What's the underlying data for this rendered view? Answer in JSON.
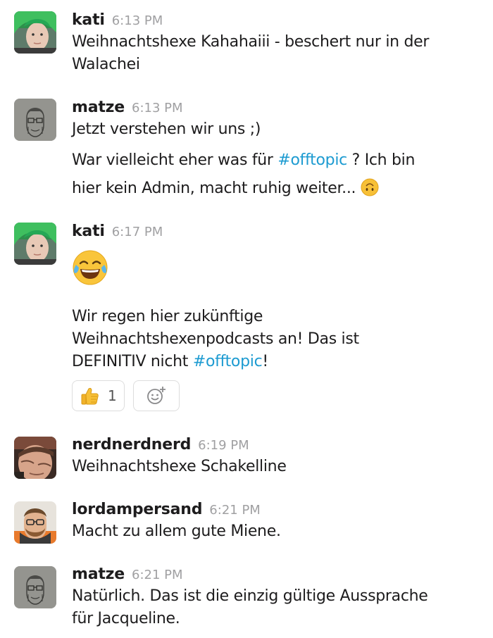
{
  "messages": [
    {
      "author": "kati",
      "time": "6:13 PM",
      "lines": [
        "Weihnachtshexe Kahahaiii - beschert nur in der",
        "Walachei"
      ]
    },
    {
      "author": "matze",
      "time": "6:13 PM",
      "text1": "Jetzt verstehen wir uns ;)",
      "text2_pre": "War vielleicht eher was für ",
      "text2_channel": "#offtopic",
      "text2_post": " ? Ich bin",
      "text3": "hier kein Admin, macht ruhig weiter... ",
      "text3_emoji": "upside-down-face-icon"
    },
    {
      "author": "kati",
      "time": "6:17 PM",
      "emoji": "joy-icon",
      "line1": "Wir regen hier zukünftige",
      "line2": "Weihnachtshexenpodcasts an! Das ist",
      "line3_pre": "DEFINITIV nicht ",
      "line3_channel": "#offtopic",
      "line3_post": "!",
      "reaction": {
        "emoji": "thumbs-up-icon",
        "count": "1"
      }
    },
    {
      "author": "nerdnerdnerd",
      "time": "6:19 PM",
      "text": "Weihnachtshexe Schakelline"
    },
    {
      "author": "lordampersand",
      "time": "6:21 PM",
      "text": "Macht zu allem gute Miene."
    },
    {
      "author": "matze",
      "time": "6:21 PM",
      "lines": [
        "Natürlich. Das ist die einzig gültige Aussprache",
        "für Jacqueline."
      ]
    }
  ],
  "colors": {
    "channel_link": "#1d9bd1",
    "timestamp": "#a0a0a2",
    "text": "#1d1c1d"
  }
}
